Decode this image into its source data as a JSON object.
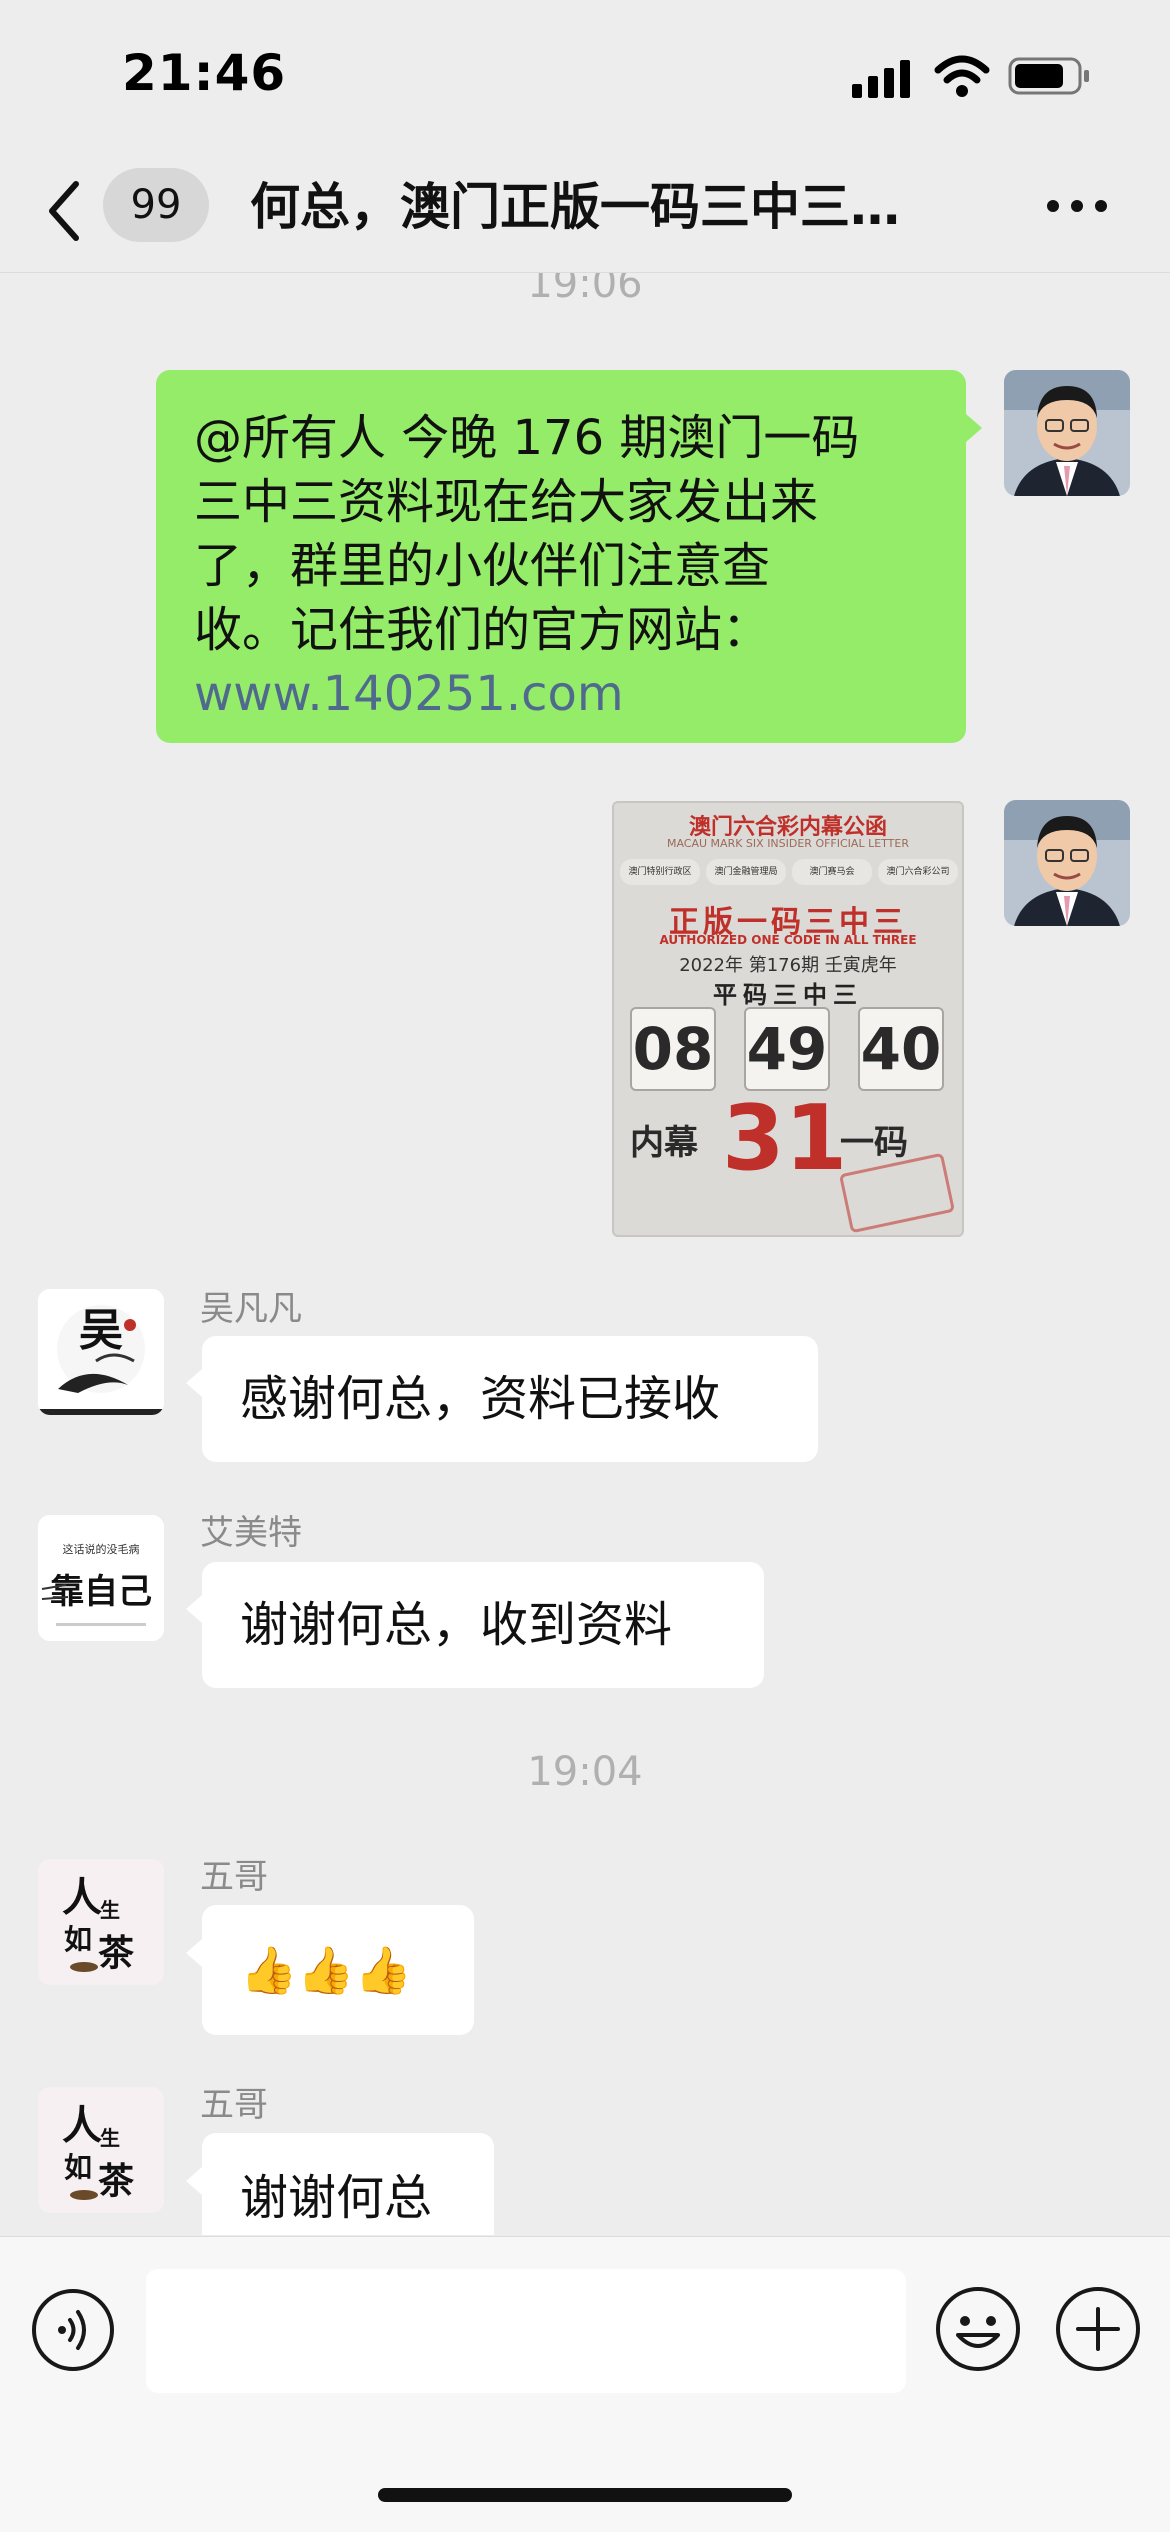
{
  "status_bar": {
    "time": "21:46"
  },
  "nav": {
    "unread_count": "99",
    "title": "何总，澳门正版一码三中三…"
  },
  "messages": {
    "time_top": "19:06",
    "m1": {
      "line1": "@所有人 今晚 176 期澳门一码",
      "line2": "三中三资料现在给大家发出来",
      "line3": "了，群里的小伙伴们注意查",
      "line4": "收。记住我们的官方网站：",
      "link": "www.140251.com"
    },
    "poster": {
      "title": "澳门六合彩内幕公函",
      "subtitle_en": "MACAU MARK SIX INSIDER OFFICIAL LETTER",
      "logos": [
        "澳门特别行政区",
        "澳门金融管理局",
        "澳门赛马会",
        "澳门六合彩公司"
      ],
      "headline": "正版一码三中三",
      "headline_en": "AUTHORIZED ONE CODE IN ALL THREE",
      "issue": "2022年 第176期 壬寅虎年",
      "flat_label": "平码三中三",
      "numbers": [
        "08",
        "49",
        "40"
      ],
      "inner_left": "内幕",
      "special": "31",
      "inner_right": "一码"
    },
    "m3": {
      "name": "吴凡凡",
      "text": "感谢何总，资料已接收"
    },
    "m4": {
      "name": "艾美特",
      "text": "谢谢何总，收到资料"
    },
    "time_mid": "19:04",
    "m5": {
      "name": "五哥",
      "text": "👍👍👍"
    },
    "m6": {
      "name": "五哥",
      "text": "谢谢何总"
    }
  },
  "avatars": {
    "wu": "吴",
    "ai": "这话说的没毛病",
    "wuge": "人生如茶"
  },
  "icons": {
    "back": "back-icon",
    "more": "more-icon",
    "voice": "voice-icon",
    "emoji": "emoji-icon",
    "plus": "plus-icon"
  },
  "colors": {
    "sent_bubble": "#95ec69",
    "received_bubble": "#ffffff",
    "background": "#ededed",
    "link": "#506a8e",
    "poster_red": "#c0302a"
  }
}
